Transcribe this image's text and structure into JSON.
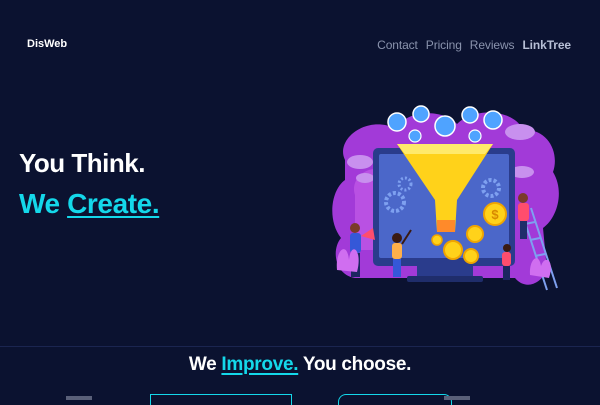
{
  "nav": {
    "brand": "DisWeb",
    "links": [
      "Contact",
      "Pricing",
      "Reviews",
      "LinkTree"
    ]
  },
  "hero": {
    "line1": "You Think.",
    "line2_prefix": "We ",
    "line2_emph": "Create."
  },
  "tagline": {
    "prefix": "We ",
    "emph": "Improve.",
    "suffix": " You choose."
  },
  "colors": {
    "background": "#0b1230",
    "accent": "#14d8ea",
    "nav_text": "#8a93ad",
    "illustration_purple": "#a23ad8",
    "funnel_yellow": "#ffd21a"
  },
  "icons": {
    "illustration": "marketing-funnel-illustration"
  }
}
